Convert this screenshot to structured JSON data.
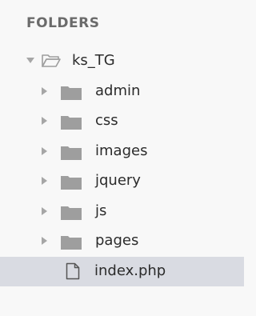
{
  "sidebar": {
    "header": "FOLDERS",
    "root": {
      "name": "ks_TG",
      "expanded": true
    },
    "items": [
      {
        "name": "admin",
        "type": "folder"
      },
      {
        "name": "css",
        "type": "folder"
      },
      {
        "name": "images",
        "type": "folder"
      },
      {
        "name": "jquery",
        "type": "folder"
      },
      {
        "name": "js",
        "type": "folder"
      },
      {
        "name": "pages",
        "type": "folder"
      },
      {
        "name": "index.php",
        "type": "file",
        "selected": true
      }
    ]
  },
  "colors": {
    "background": "#f8f8f8",
    "selected_row": "#d9dbe2",
    "folder": "#9e9e9e",
    "arrow": "#a6a6a6",
    "header_text": "#6b6b6b"
  },
  "icons": {
    "root": "open-folder-icon",
    "folder": "folder-icon",
    "file": "file-icon",
    "expanded": "triangle-down-icon",
    "collapsed": "triangle-right-icon"
  }
}
